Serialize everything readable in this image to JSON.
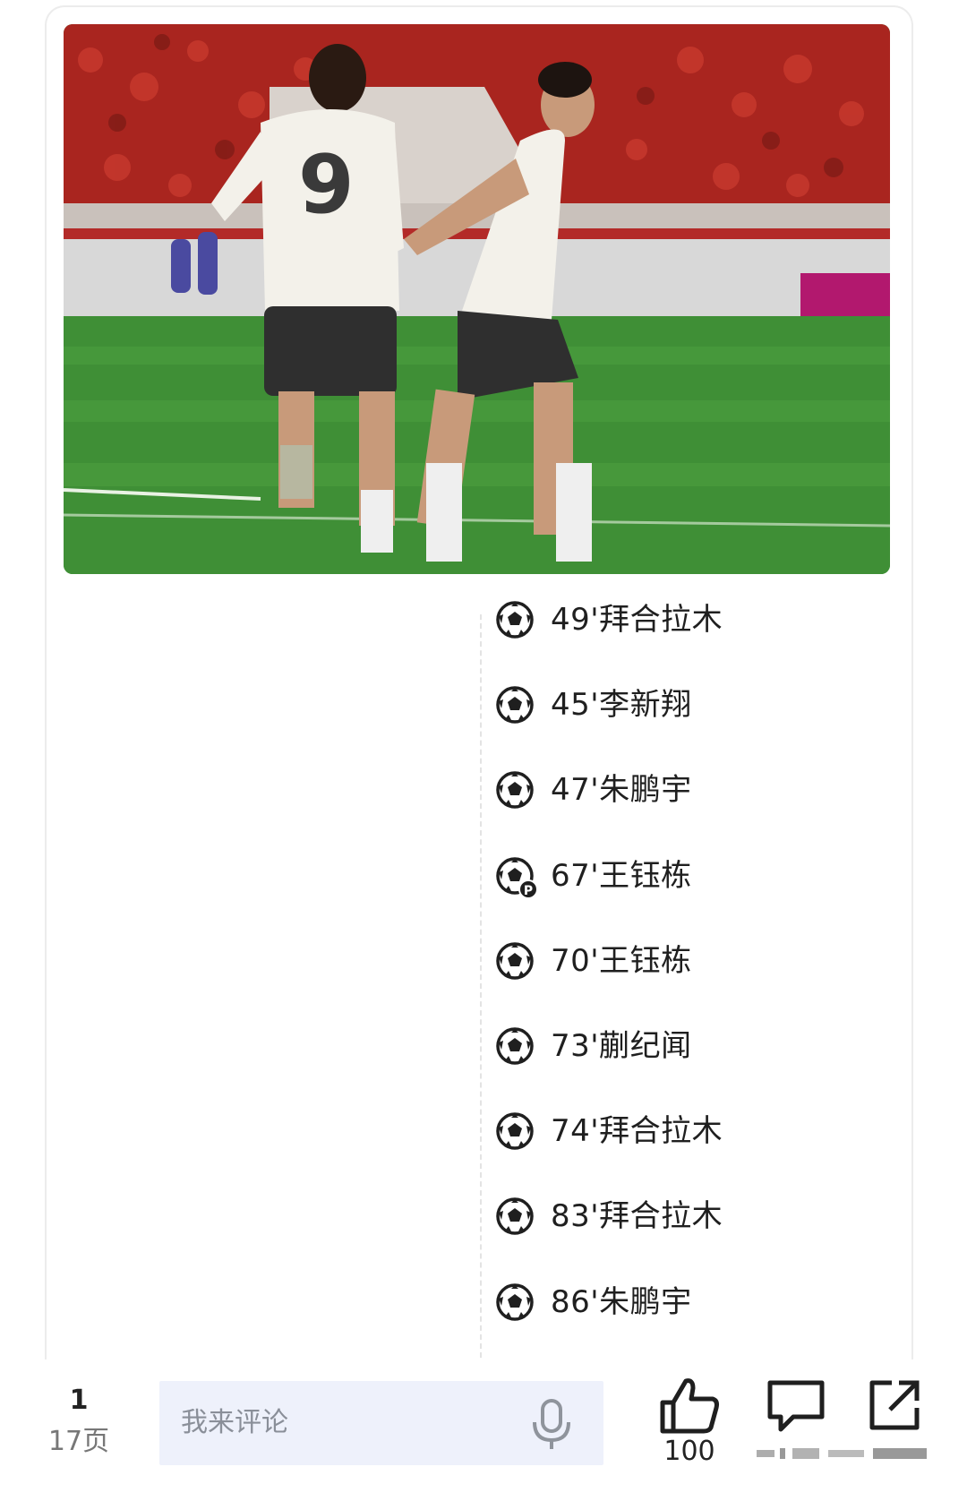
{
  "goals": [
    {
      "text": "49'拜合拉木",
      "icon": "soccer-ball-icon"
    },
    {
      "text": "45'李新翔",
      "icon": "soccer-ball-icon"
    },
    {
      "text": "47'朱鹏宇",
      "icon": "soccer-ball-icon"
    },
    {
      "text": "67'王钰栋",
      "icon": "soccer-ball-penalty-icon",
      "badge": "P"
    },
    {
      "text": "70'王钰栋",
      "icon": "soccer-ball-icon"
    },
    {
      "text": "73'蒯纪闻",
      "icon": "soccer-ball-icon"
    },
    {
      "text": "74'拜合拉木",
      "icon": "soccer-ball-icon"
    },
    {
      "text": "83'拜合拉木",
      "icon": "soccer-ball-icon"
    },
    {
      "text": "86'朱鹏宇",
      "icon": "soccer-ball-icon"
    }
  ],
  "bottom_bar": {
    "page_current": "1",
    "page_total": "17页",
    "comment_placeholder": "我来评论",
    "like_count": "100"
  },
  "photo": {
    "jersey_number": "9"
  }
}
